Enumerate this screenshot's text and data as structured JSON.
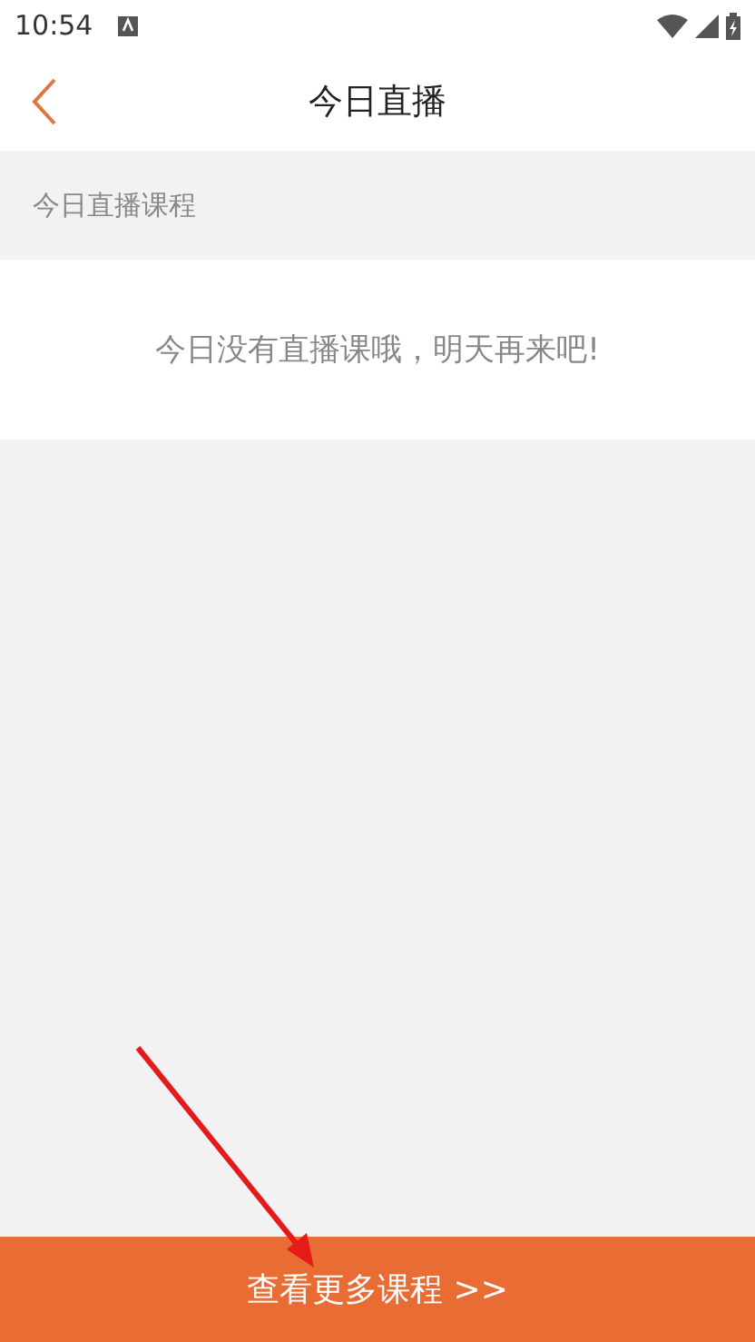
{
  "status_bar": {
    "time": "10:54"
  },
  "header": {
    "title": "今日直播"
  },
  "section": {
    "title": "今日直播课程"
  },
  "empty_message": "今日没有直播课哦，明天再来吧!",
  "footer_button": {
    "label": "查看更多课程 >>"
  }
}
